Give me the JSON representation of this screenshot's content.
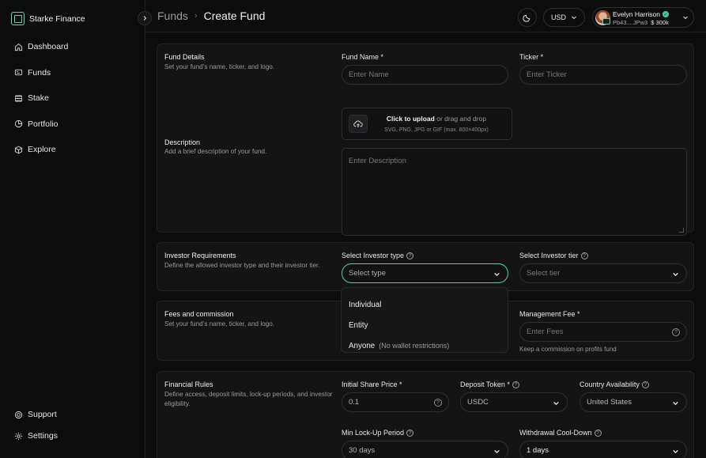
{
  "app": {
    "name": "Starke Finance"
  },
  "sidebar": {
    "items": [
      {
        "label": "Dashboard",
        "icon": "home-icon"
      },
      {
        "label": "Funds",
        "icon": "funds-icon"
      },
      {
        "label": "Stake",
        "icon": "stake-icon"
      },
      {
        "label": "Portfolio",
        "icon": "portfolio-icon"
      },
      {
        "label": "Explore",
        "icon": "explore-icon"
      }
    ],
    "bottom_items": [
      {
        "label": "Support",
        "icon": "support-icon"
      },
      {
        "label": "Settings",
        "icon": "gear-icon"
      }
    ]
  },
  "header": {
    "breadcrumb_parent": "Funds",
    "breadcrumb_current": "Create Fund",
    "currency": "USD",
    "user": {
      "name": "Evelyn Harrison",
      "wallet": "Pb43....JPw3",
      "balance": "$ 300k"
    }
  },
  "fund_details": {
    "title": "Fund Details",
    "description": "Set your fund’s name, ticker, and logo.",
    "name_label": "Fund Name *",
    "name_placeholder": "Enter Name",
    "ticker_label": "Ticker *",
    "ticker_placeholder": "Enter Ticker",
    "upload_cta": "Click to upload",
    "upload_alt": "or drag and drop",
    "upload_formats": "SVG, PNG, JPG or GIF (max. 800×400px)"
  },
  "description_section": {
    "title": "Description",
    "description": "Add a brief description of your fund.",
    "placeholder": "Enter Description"
  },
  "investor": {
    "title": "Investor Requirements",
    "description": "Define the allowed investor type and their investor tier.",
    "type_label": "Select Investor type",
    "type_placeholder": "Select type",
    "tier_label": "Select Investor tier",
    "tier_placeholder": "Select tier",
    "type_options": [
      {
        "label": "Individual",
        "note": ""
      },
      {
        "label": "Entity",
        "note": ""
      },
      {
        "label": "Anyone",
        "note": "(No wallet restrictions)"
      }
    ]
  },
  "fees": {
    "title": "Fees and commission",
    "description": "Set your fund’s name, ticker, and logo.",
    "management_label": "Management Fee *",
    "management_placeholder": "Enter Fees",
    "management_hint": "Keep a commission on profits fund"
  },
  "financial": {
    "title": "Financial Rules",
    "description": "Define access, deposit limits, lock-up periods, and investor eligibility.",
    "share_price_label": "Initial Share Price *",
    "share_price_value": "0.1",
    "deposit_token_label": "Deposit Token *",
    "deposit_token_value": "USDC",
    "country_label": "Country Availability",
    "country_value": "United States",
    "lockup_label": "Min Lock-Up Period",
    "lockup_value": "30 days",
    "cooldown_label": "Withdrawal Cool-Down",
    "cooldown_value": "1 days"
  },
  "colors": {
    "accent": "#4fd0b0",
    "background": "#0d0d0e",
    "card": "#141415"
  }
}
